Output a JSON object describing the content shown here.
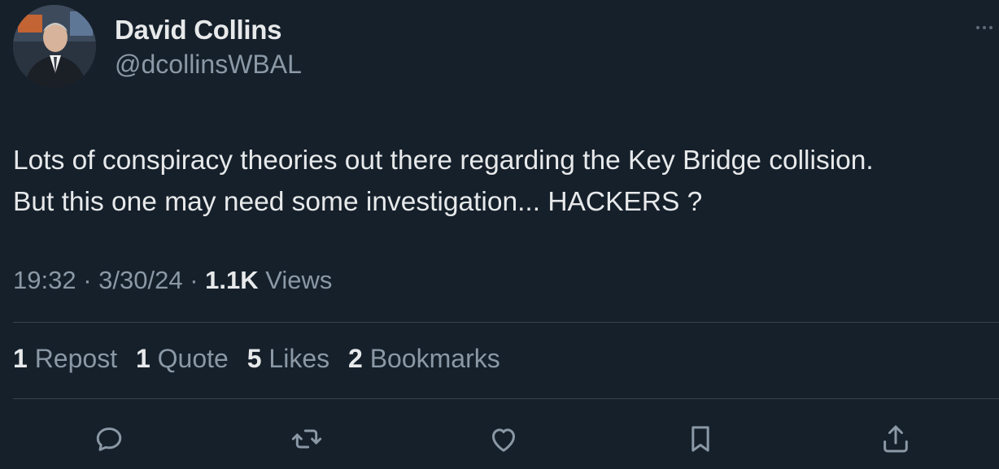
{
  "author": {
    "name": "David Collins",
    "handle": "@dcollinsWBAL",
    "avatar_icon": "avatar-photo"
  },
  "tweet": {
    "line1": "Lots of conspiracy theories out there regarding the Key Bridge collision.",
    "line2": "But this one may need some investigation... HACKERS ?"
  },
  "meta": {
    "time": "19:32",
    "sep1": " · ",
    "date": "3/30/24",
    "sep2": " · ",
    "views_count": "1.1K",
    "views_label": " Views"
  },
  "stats": [
    {
      "count": "1",
      "label": " Repost"
    },
    {
      "count": "1",
      "label": " Quote"
    },
    {
      "count": "5",
      "label": " Likes"
    },
    {
      "count": "2",
      "label": " Bookmarks"
    }
  ],
  "actions": [
    {
      "icon": "reply-icon"
    },
    {
      "icon": "retweet-icon"
    },
    {
      "icon": "like-icon"
    },
    {
      "icon": "bookmark-icon"
    },
    {
      "icon": "share-icon"
    }
  ],
  "colors": {
    "background": "#15202b",
    "primary_text": "#e7e9ea",
    "secondary_text": "#8b98a5",
    "divider": "#38444d"
  }
}
